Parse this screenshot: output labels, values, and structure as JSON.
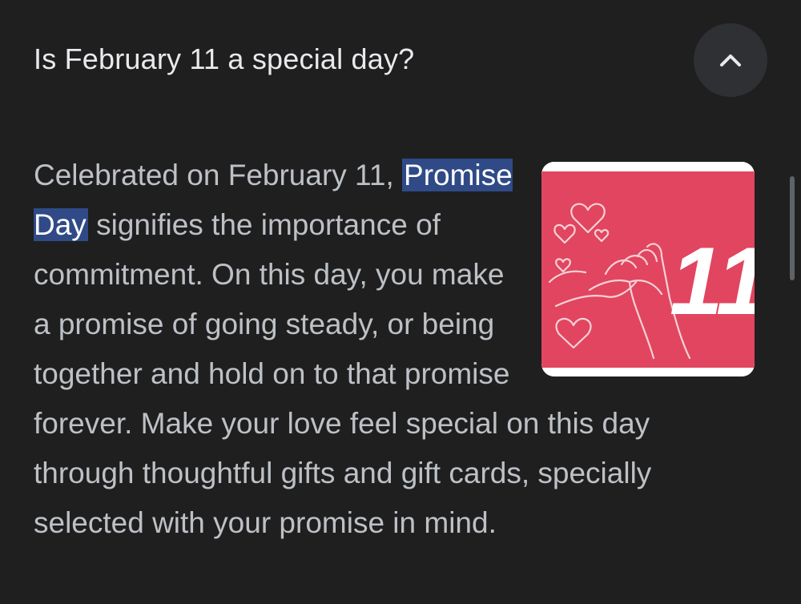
{
  "faq": {
    "question": "Is February 11 a special day?",
    "toggle_icon": "chevron-up-icon",
    "answer": {
      "before_highlight": "Celebrated on February 11, ",
      "highlight": "Promise Day",
      "after_highlight": " signifies the importance of commitment. On this day, you make a promise of going steady, or being together and hold on to that promise forever. Make your love feel special on this day through thoughtful gifts and gift cards, specially selected with your promise in mind."
    },
    "thumbnail": {
      "label": "11",
      "background_color": "#e1455f",
      "icon": "promise-hands-hearts-icon"
    }
  },
  "colors": {
    "background": "#1f1f1f",
    "question_text": "#e8eaed",
    "body_text": "#bdc1c6",
    "highlight_bg": "#2f4a86",
    "toggle_bg": "#2f3033"
  }
}
